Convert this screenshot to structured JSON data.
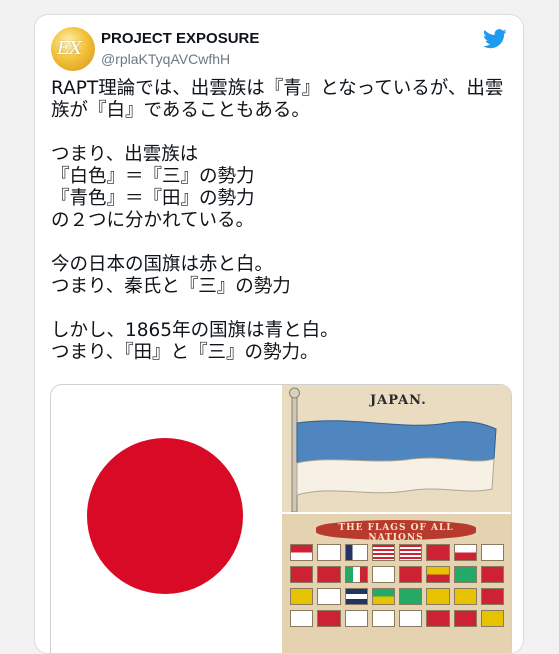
{
  "tweet": {
    "display_name": "PROJECT EXPOSURE",
    "handle": "@rplaKTyqAVCwfhH",
    "avatar_mark": "EX",
    "paragraphs": [
      "RAPT理論では、出雲族は『青』となっているが、出雲族が『白』であることもある。",
      "つまり、出雲族は\n『白色』＝『三』の勢力\n『青色』＝『田』の勢力\nの２つに分かれている。",
      "今の日本の国旗は赤と白。\nつまり、秦氏と『三』の勢力",
      "しかし、1865年の国旗は青と白。\nつまり、『田』と『三』の勢力。"
    ]
  },
  "media": {
    "historic_flag_title": "JAPAN.",
    "flags_chart_banner": "THE FLAGS OF ALL NATIONS"
  },
  "colors": {
    "twitter_blue": "#1d9bf0",
    "hinomaru_red": "#d80a25",
    "historic_flag_blue": "#4f86bf"
  }
}
